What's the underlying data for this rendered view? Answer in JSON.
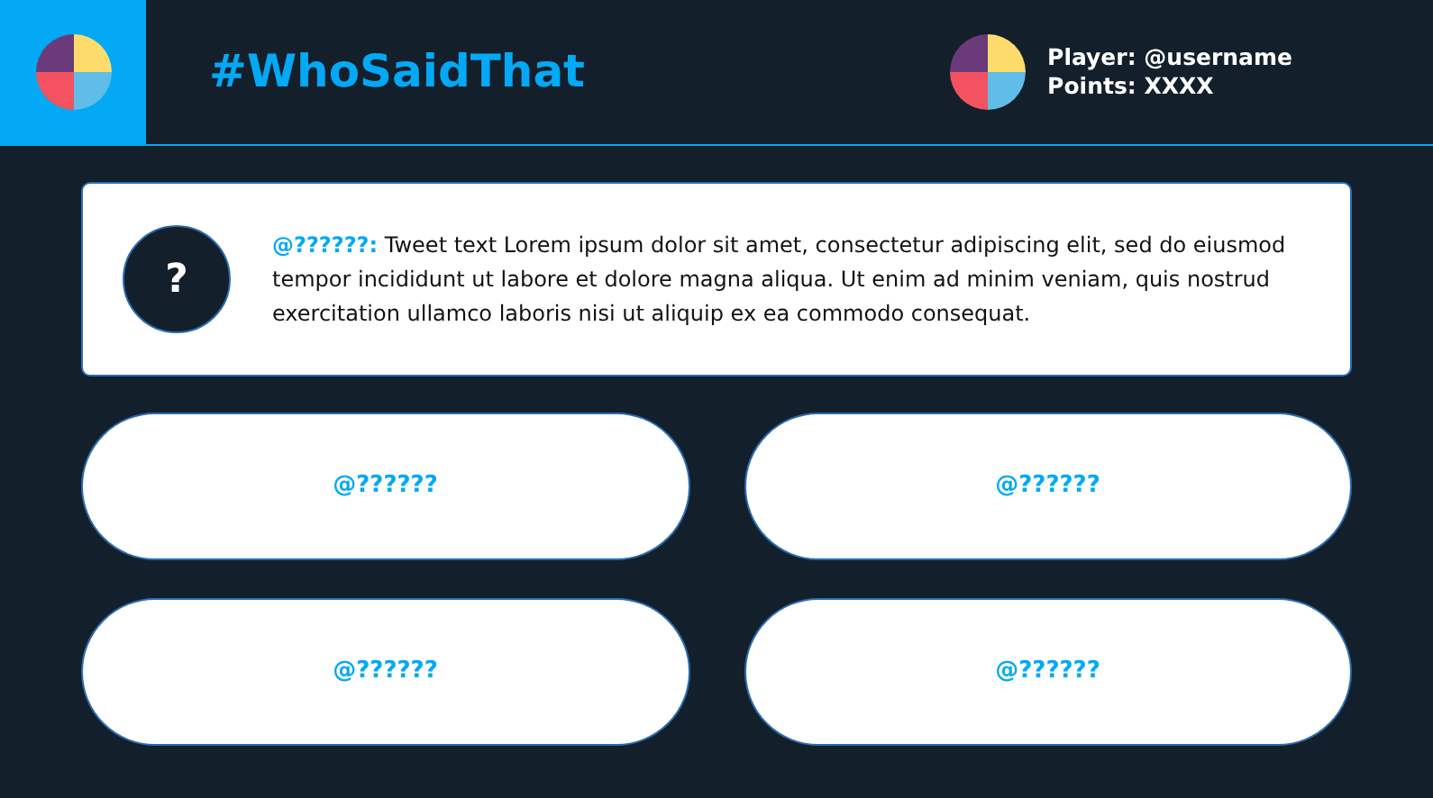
{
  "header": {
    "title": "#WhoSaidThat",
    "player": "Player: @username",
    "points": "Points: XXXX"
  },
  "question": {
    "mark": "?",
    "handle": "@??????:",
    "text": " Tweet text Lorem ipsum dolor sit amet, consectetur adipiscing elit, sed do eiusmod tempor incididunt ut labore et dolore magna aliqua. Ut enim ad minim veniam, quis nostrud exercitation ullamco laboris nisi ut aliquip ex ea commodo consequat."
  },
  "answers": [
    {
      "label": "@??????"
    },
    {
      "label": "@??????"
    },
    {
      "label": "@??????"
    },
    {
      "label": "@??????"
    }
  ]
}
